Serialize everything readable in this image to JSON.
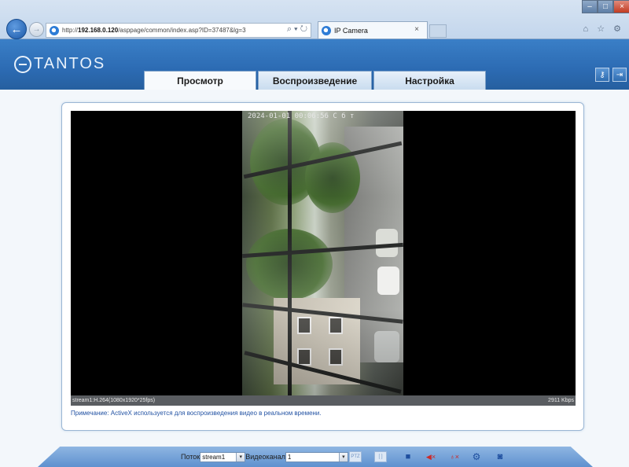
{
  "browser": {
    "address_prefix": "http://",
    "address_host": "192.168.0.120",
    "address_path": "/asppage/common/index.asp?ID=37487&lg=3",
    "address_controls": "⌕ ▾ ↻",
    "tab_title": "IP Camera",
    "tab_close": "×",
    "back_icon": "←",
    "fwd_icon": "→",
    "minimize": "–",
    "maximize": "□",
    "close": "×",
    "toolbar_icons": "⌂ ☆ ⚙"
  },
  "app": {
    "logo": "TANTOS",
    "tabs": [
      {
        "label": "Просмотр",
        "active": true
      },
      {
        "label": "Воспроизведение",
        "active": false
      },
      {
        "label": "Настройка",
        "active": false
      }
    ],
    "user_icon": "⚷",
    "exit_icon": "⇥"
  },
  "video": {
    "osd_time": "2024-01-01 00:06:56 С б т",
    "stream_info": "stream1:H.264(1080x1920*25fps)",
    "bitrate": "2911 Kbps",
    "note": "Примечание: ActiveX используется для воспроизведения видео в реальном времени."
  },
  "controls": {
    "stream_label": "Поток",
    "stream_value": "stream1",
    "channel_label": "Видеоканал",
    "channel_value": "1",
    "select_arrow": "▾",
    "ptz_label": "PTZ",
    "full_label": "[ ]",
    "stop_glyph": "■",
    "audio_glyph": "◀×",
    "mic_glyph": "♁×",
    "gear_glyph": "⚙",
    "snap_glyph": "◙"
  },
  "colors": {
    "accent": "#2c6bb3",
    "panel_border": "#9ab6d4",
    "note_text": "#2252a3"
  }
}
